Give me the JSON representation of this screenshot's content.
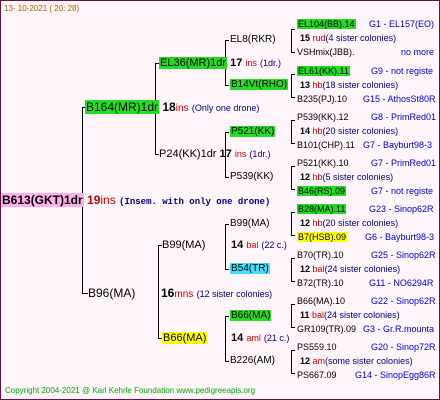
{
  "date": "13- 10-2021 ( 20: 28)",
  "footer": "Copyright 2004-2021 @ Karl Kehrle Foundation   www.pedigreeapis.org",
  "root": {
    "name": "B613(GKT)1dr",
    "num": "19",
    "sym": "ins",
    "note": "(Insem. with only one drone)"
  },
  "sire": {
    "name": "B164(MR)1dr",
    "num": "18",
    "sym": "ins",
    "note": "(Only one drone)"
  },
  "dam": {
    "name": "B96(MA)",
    "num": "16",
    "sym": "mns",
    "note": "(12 sister colonies)"
  },
  "sire_sire": {
    "name": "EL36(MR)1dr",
    "num": "17",
    "sym": "ins",
    "note": "(1dr.)"
  },
  "sire_dam": {
    "name": "P24(KK)1dr",
    "num": "17",
    "sym": "ins",
    "note": "(1dr.)"
  },
  "dam_sire": {
    "name": "B99(MA)",
    "num": "14",
    "sym": "bal",
    "note": "(22 c.)"
  },
  "dam_dam": {
    "name": "B66(MA)",
    "num": "14",
    "sym": "aml",
    "note": "(21 c.)"
  },
  "g3": [
    {
      "name": "EL8(RKR)"
    },
    {
      "name": "B14Vt(RHO)"
    },
    {
      "name": "P521(KK)"
    },
    {
      "name": "P539(KK)"
    },
    {
      "name": "B99(MA)"
    },
    {
      "name": "B54(TR)"
    },
    {
      "name": "B66(MA)"
    },
    {
      "name": "B226(AM)"
    }
  ],
  "g4": [
    {
      "top": "EL104(BB).14",
      "top_right": "G1 - EL157(EO)",
      "num": "15",
      "sym": "rud",
      "note": "(4 sister colonies)",
      "bot": "VSHmix(JBB).",
      "bot_right": "no more"
    },
    {
      "top": "EL61(KK).11",
      "top_right": "G9 - not registe",
      "num": "13",
      "sym": "hb",
      "note": "(18 sister colonies)",
      "bot": "B235(PJ).10",
      "bot_right": "G15 - AthosSt80R"
    },
    {
      "top": "P539(KK).12",
      "top_right": "G8 - PrimRed01",
      "num": "14",
      "sym": "hb",
      "note": "(20 sister colonies)",
      "bot": "B101(CHP).11",
      "bot_right": "G7 - Bayburt98-3"
    },
    {
      "top": "P521(KK).10",
      "top_right": "G7 - PrimRed01",
      "num": "12",
      "sym": "hb",
      "note": "(5 sister colonies)",
      "bot": "B46(RS).09",
      "bot_right": "G7 - not registe"
    },
    {
      "top": "B28(MA).11",
      "top_right": "G23 - Sinop62R",
      "num": "12",
      "sym": "hb",
      "note": "(20 sister colonies)",
      "bot": "B7(HSB).09",
      "bot_right": "G6 - Bayburt98-3"
    },
    {
      "top": "B70(TR).10",
      "top_right": "G25 - Sinop62R",
      "num": "12",
      "sym": "bal",
      "note": "(24 sister colonies)",
      "bot": "B72(TR).10",
      "bot_right": "G11 - NO6294R"
    },
    {
      "top": "B66(MA).10",
      "top_right": "G22 - Sinop62R",
      "num": "11",
      "sym": "bal",
      "note": "(24 sister colonies)",
      "bot": "GR109(TR).09",
      "bot_right": "G3 - Gr.R.mounta"
    },
    {
      "top": "PS559.10",
      "top_right": "G20 - Sinop72R",
      "num": "12",
      "sym": "am",
      "note": "(some sister colonies)",
      "bot": "PS667.09",
      "bot_right": "G14 - SinopEgg86R"
    }
  ]
}
